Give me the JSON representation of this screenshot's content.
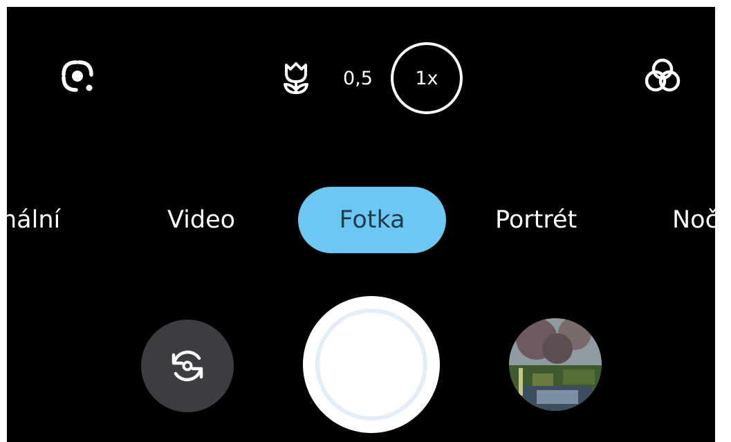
{
  "theme": {
    "background": "#000000",
    "text": "#ffffff",
    "accent": "#6cc8f2",
    "accent_text": "#1e3a4d",
    "button_gray": "#3b3d40"
  },
  "top_bar": {
    "left_icon": "lens-scan-icon",
    "macro_icon": "tulip-macro-icon",
    "zoom_options": [
      "0,5",
      "1x"
    ],
    "zoom_selected": "1x",
    "right_icon": "color-filter-icon"
  },
  "modes": {
    "items": [
      "nální",
      "Video",
      "Fotka",
      "Portrét",
      "Noč"
    ],
    "selected": "Fotka"
  },
  "bottom_bar": {
    "flip_icon": "switch-camera-icon",
    "shutter_icon": "shutter-button",
    "gallery_icon": "gallery-thumbnail"
  }
}
